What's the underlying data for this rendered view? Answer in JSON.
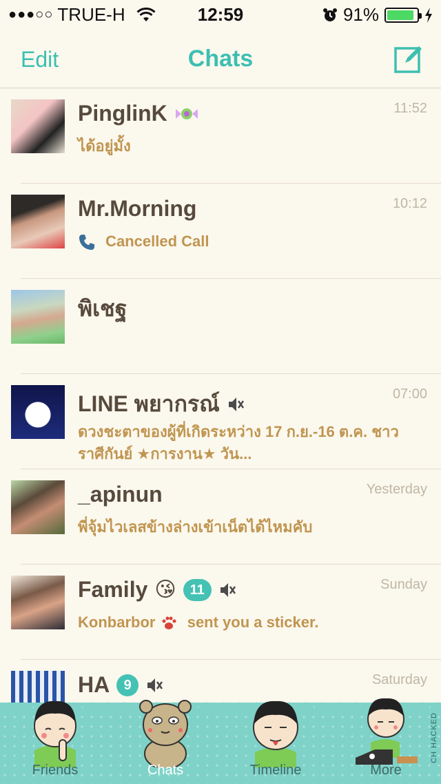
{
  "status_bar": {
    "signal": "●●●○○",
    "carrier": "TRUE-H",
    "time": "12:59",
    "battery_percent": "91%",
    "battery_level": 0.91
  },
  "nav": {
    "edit_label": "Edit",
    "title": "Chats"
  },
  "chats": [
    {
      "name": "PinglinK",
      "time": "11:52",
      "preview": "ได้อยู่มั้ง"
    },
    {
      "name": "Mr.Morning",
      "time": "10:12",
      "preview": "Cancelled Call"
    },
    {
      "name": "พิเชฐ",
      "time": "",
      "preview": ""
    },
    {
      "name": "LINE พยากรณ์",
      "time": "07:00",
      "preview": "ดวงชะตาของผู้ที่เกิดระหว่าง 17 ก.ย.-16 ต.ค. ชาวราศีกันย์ ★การงาน★ วัน..."
    },
    {
      "name": "_apinun",
      "time": "Yesterday",
      "preview": "พี่จุ้มไวเลสข้างล่างเข้าเน็ตได้ไหมคับ"
    },
    {
      "name": "Family",
      "time": "Sunday",
      "badge": "11",
      "emoji": "😘",
      "preview_sender": "Konbarbor",
      "preview_text": "sent you a sticker."
    },
    {
      "name": "HA",
      "time": "Saturday",
      "badge": "9",
      "preview": ""
    }
  ],
  "tabs": [
    {
      "label": "Friends"
    },
    {
      "label": "Chats"
    },
    {
      "label": "Timeline"
    },
    {
      "label": "More"
    }
  ],
  "watermark": "CH HACKED",
  "colors": {
    "accent": "#3cbfb0",
    "background": "#fbf8ee",
    "preview_text": "#c09550",
    "name_text": "#574a3c",
    "badge": "#44c2b4",
    "tab_bar": "#7fd2c8"
  }
}
